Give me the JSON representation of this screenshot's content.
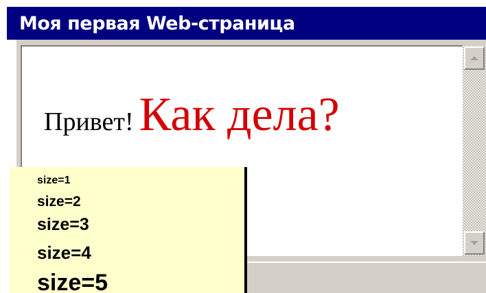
{
  "window": {
    "title": "Моя первая Web-страница"
  },
  "page": {
    "greeting": "Привет!",
    "question": "Как дела?"
  },
  "note": {
    "items": [
      "size=1",
      "size=2",
      "size=3",
      "size=4",
      "size=5"
    ]
  },
  "colors": {
    "titlebar": "#000080",
    "question_text": "#d40000",
    "note_background": "#ffffcc",
    "window_chrome": "#d4d0c8"
  },
  "icons": {
    "scroll_up": "arrow-up",
    "scroll_down": "arrow-down"
  }
}
